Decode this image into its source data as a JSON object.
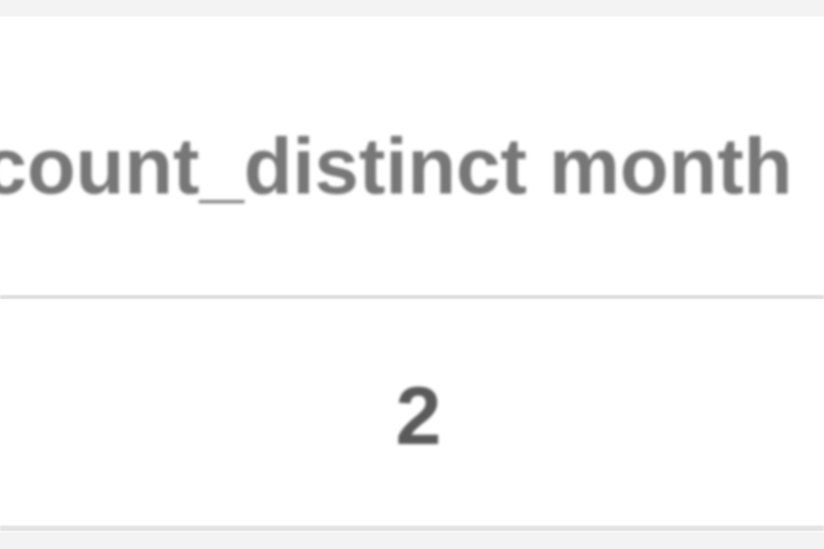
{
  "table": {
    "columns": [
      {
        "label": "count_distinct month"
      }
    ],
    "rows": [
      [
        "2"
      ]
    ]
  },
  "colors": {
    "page_background": "#f3f3f3",
    "cell_background": "#ffffff",
    "header_text": "#777777",
    "value_text": "#5a5a5a",
    "divider": "#dedede"
  }
}
